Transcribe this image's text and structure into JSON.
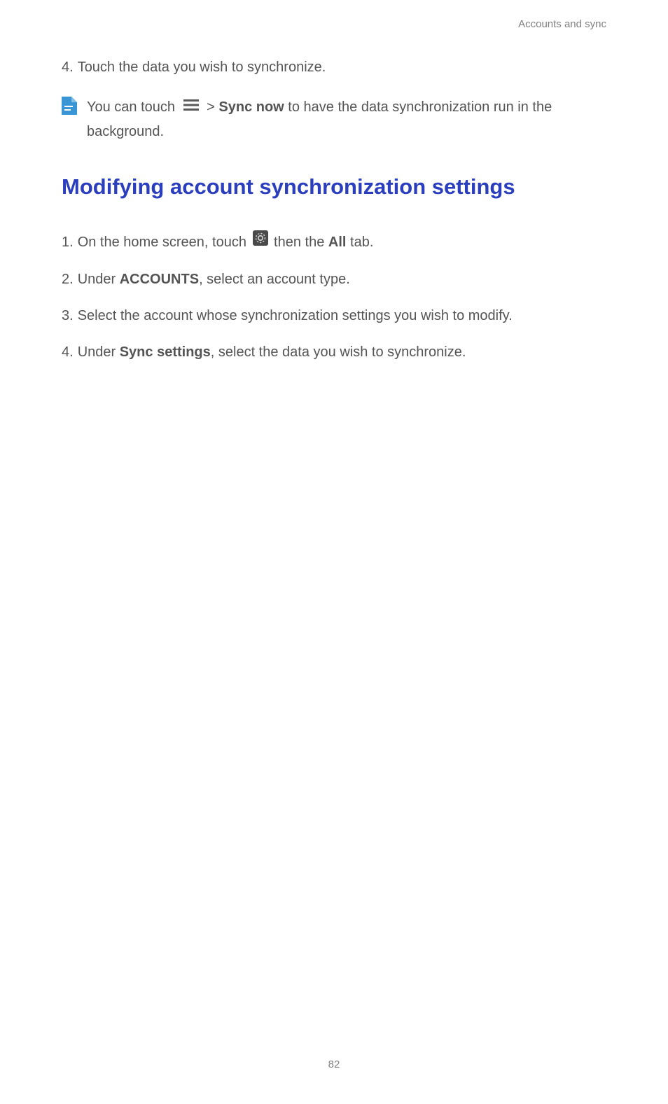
{
  "header": {
    "section_title": "Accounts and sync"
  },
  "continuation_step": {
    "number": "4.",
    "text": "Touch the data you wish to synchronize."
  },
  "note": {
    "prefix": "You can touch ",
    "separator": " > ",
    "bold_action": "Sync now",
    "suffix": " to have the data synchronization run in the background."
  },
  "heading": "Modifying account synchronization settings",
  "steps": [
    {
      "number": "1.",
      "prefix": "On the home screen, touch ",
      "mid": " then the ",
      "bold": "All",
      "suffix": " tab."
    },
    {
      "number": "2.",
      "prefix": "Under ",
      "bold": "ACCOUNTS",
      "suffix": ", select an account type."
    },
    {
      "number": "3.",
      "text": "Select the account whose synchronization settings you wish to modify."
    },
    {
      "number": "4.",
      "prefix": "Under ",
      "bold": "Sync settings",
      "suffix": ", select the data you wish to synchronize."
    }
  ],
  "page_number": "82"
}
